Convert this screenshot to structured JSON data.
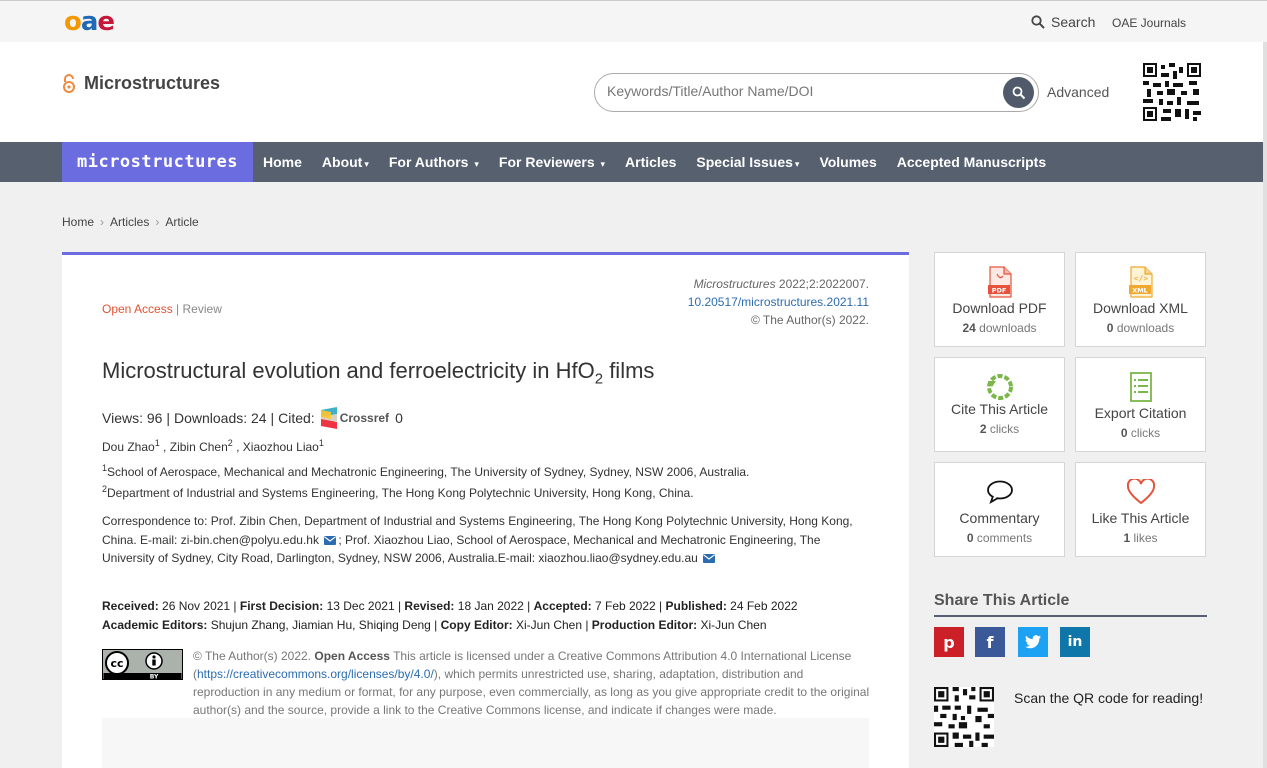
{
  "topbar": {
    "logo": {
      "o": "o",
      "a": "a",
      "e": "e"
    },
    "search_label": "Search",
    "journals_label": "OAE Journals"
  },
  "header": {
    "journal_name": "Microstructures",
    "search_placeholder": "Keywords/Title/Author Name/DOI",
    "advanced_label": "Advanced"
  },
  "nav": {
    "logo_text": "microstructures",
    "items": [
      "Home",
      "About",
      "For Authors",
      "For Reviewers",
      "Articles",
      "Special Issues",
      "Volumes",
      "Accepted Manuscripts"
    ],
    "caret": "▾"
  },
  "breadcrumb": [
    "Home",
    "Articles",
    "Article"
  ],
  "article": {
    "open_access": "Open Access",
    "separator": " | ",
    "type": "Review",
    "journal_ref": "Microstructures",
    "journal_ref_rest": " 2022;2:2022007.",
    "doi": "10.20517/microstructures.2021.11",
    "copyright": "© The Author(s) 2022.",
    "title_main": "Microstructural evolution and ferroelectricity in HfO",
    "title_sub": "2",
    "title_end": " films",
    "views": "Views: 96 |",
    "downloads": "Downloads: 24 |",
    "cited": "Cited:",
    "crossref": "Crossref",
    "cited_count": "0",
    "authors": [
      {
        "name": "Dou Zhao",
        "sup": "1"
      },
      {
        "name": "Zibin Chen",
        "sup": "2"
      },
      {
        "name": "Xiaozhou Liao",
        "sup": "1"
      }
    ],
    "affiliations": [
      {
        "sup": "1",
        "text": "School of Aerospace, Mechanical and Mechatronic Engineering, The University of Sydney, Sydney, NSW 2006, Australia."
      },
      {
        "sup": "2",
        "text": "Department of Industrial and Systems Engineering, The Hong Kong Polytechnic University, Hong Kong, China."
      }
    ],
    "correspondence_1": "Correspondence to: Prof. Zibin Chen, Department of Industrial and Systems Engineering, The Hong Kong Polytechnic University, Hong Kong, China. E-mail: zi-bin.chen@polyu.edu.hk",
    "correspondence_2": "; Prof. Xiaozhou Liao, School of Aerospace, Mechanical and Mechatronic Engineering, The University of Sydney, City Road, Darlington, Sydney, NSW 2006, Australia.E-mail: xiaozhou.liao@sydney.edu.au",
    "dates": {
      "received_label": "Received:",
      "received": " 26 Nov 2021 | ",
      "first_decision_label": "First Decision:",
      "first_decision": " 13 Dec 2021 | ",
      "revised_label": "Revised:",
      "revised": " 18 Jan 2022 | ",
      "accepted_label": "Accepted:",
      "accepted": " 7 Feb 2022 | ",
      "published_label": "Published:",
      "published": " 24 Feb 2022",
      "editors_label": "Academic Editors:",
      "editors": " Shujun Zhang, Jiamian Hu, Shiqing Deng | ",
      "copy_editor_label": "Copy Editor:",
      "copy_editor": " Xi-Jun Chen | ",
      "production_editor_label": "Production Editor:",
      "production_editor": " Xi-Jun Chen"
    },
    "license": {
      "prefix": "© The Author(s) 2022. ",
      "open_access": "Open Access",
      "part1": " This article is licensed under a Creative Commons Attribution 4.0 International License (",
      "link": "https://creativecommons.org/licenses/by/4.0/",
      "part2": "), which permits unrestricted use, sharing, adaptation, distribution and reproduction in any medium or format, for any purpose, even commercially, as long as you give appropriate credit to the original author(s) and the source, provide a link to the Creative Commons license, and indicate if changes were made.",
      "cc_label": "cc",
      "by_label": "BY"
    }
  },
  "sidebar": {
    "tiles": [
      {
        "label": "Download PDF",
        "count": "24",
        "unit": " downloads",
        "icon_text": "PDF"
      },
      {
        "label": "Download XML",
        "count": "0",
        "unit": " downloads",
        "icon_text": "XML"
      },
      {
        "label": "Cite This Article",
        "count": "2",
        "unit": " clicks"
      },
      {
        "label": "Export Citation",
        "count": "0",
        "unit": " clicks"
      },
      {
        "label": "Commentary",
        "count": "0",
        "unit": " comments"
      },
      {
        "label": "Like This Article",
        "count": "1",
        "unit": " likes"
      }
    ],
    "share_title": "Share This Article",
    "share": [
      {
        "icon": "p",
        "color": "#cb2027"
      },
      {
        "icon": "f",
        "color": "#3b5998"
      },
      {
        "icon": "t",
        "color": "#1da1f2"
      },
      {
        "icon": "in",
        "color": "#0e76a8"
      }
    ],
    "qr_text": "Scan the QR code for reading!"
  }
}
